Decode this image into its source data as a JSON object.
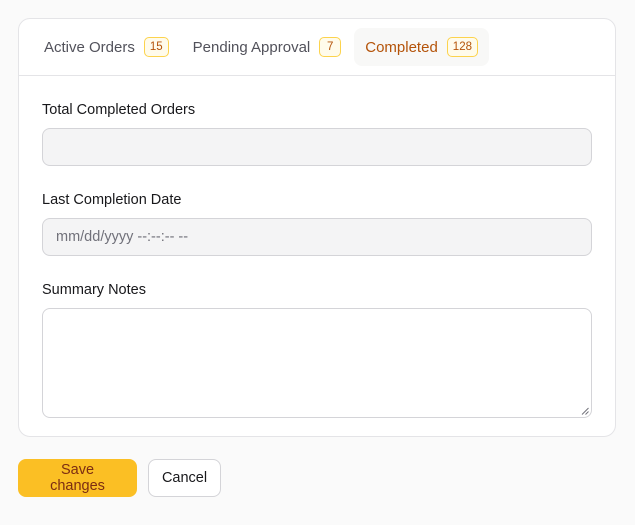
{
  "tabs": [
    {
      "label": "Active Orders",
      "count": "15"
    },
    {
      "label": "Pending Approval",
      "count": "7"
    },
    {
      "label": "Completed",
      "count": "128"
    }
  ],
  "form": {
    "total_label": "Total Completed Orders",
    "total_value": "",
    "date_label": "Last Completion Date",
    "date_placeholder": "mm/dd/yyyy --:--:-- --",
    "notes_label": "Summary Notes",
    "notes_value": ""
  },
  "actions": {
    "save_label": "Save changes",
    "cancel_label": "Cancel"
  },
  "colors": {
    "accent": "#fbbf24",
    "accent_text": "#b45309"
  }
}
